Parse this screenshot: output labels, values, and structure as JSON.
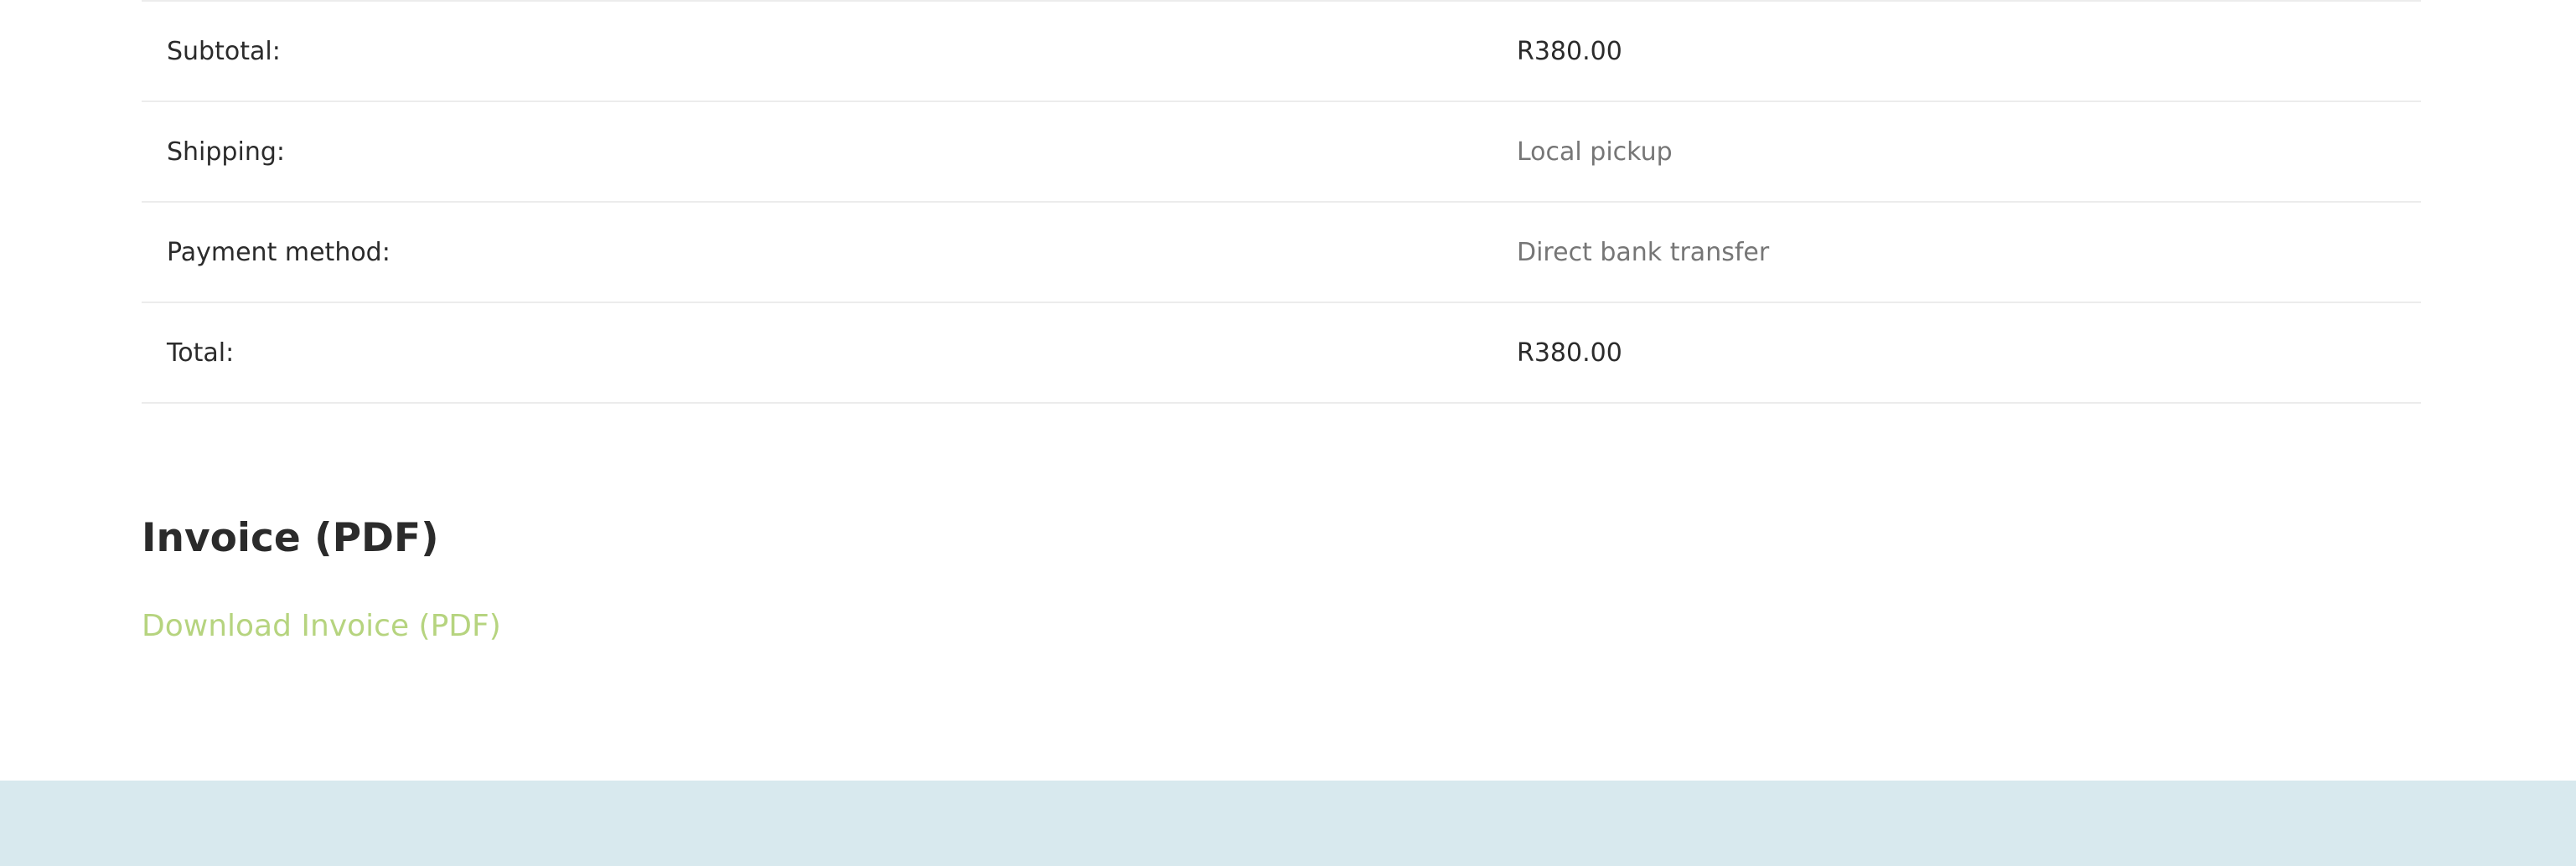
{
  "order_totals": {
    "rows": [
      {
        "label": "Subtotal:",
        "value": "R380.00"
      },
      {
        "label": "Shipping:",
        "value": "Local pickup"
      },
      {
        "label": "Payment method:",
        "value": "Direct bank transfer"
      },
      {
        "label": "Total:",
        "value": "R380.00"
      }
    ]
  },
  "invoice": {
    "heading": "Invoice (PDF)",
    "download_label": "Download Invoice (PDF)"
  },
  "colors": {
    "link": "#b6d47f",
    "footer_background": "#d8e9ee",
    "muted_text": "#767676",
    "divider": "#ececec"
  }
}
